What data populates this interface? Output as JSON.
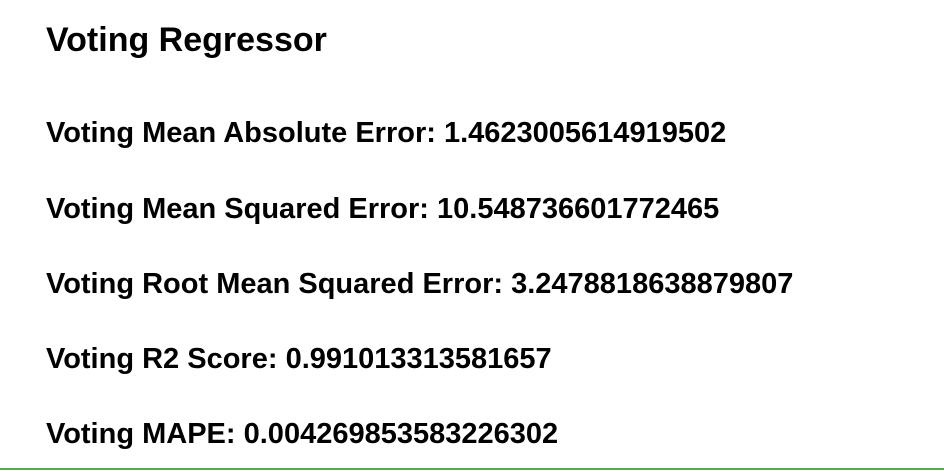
{
  "title": "Voting Regressor",
  "metrics": [
    {
      "label": "Voting Mean Absolute Error:",
      "value": "1.4623005614919502"
    },
    {
      "label": "Voting Mean Squared Error:",
      "value": "10.548736601772465"
    },
    {
      "label": "Voting Root Mean Squared Error:",
      "value": "3.2478818638879807"
    },
    {
      "label": "Voting R2 Score:",
      "value": "0.991013313581657"
    },
    {
      "label": "Voting MAPE:",
      "value": "0.004269853583226302"
    }
  ],
  "colors": {
    "text": "#000000",
    "background": "#ffffff",
    "bottom_rule": "#4caf50"
  }
}
